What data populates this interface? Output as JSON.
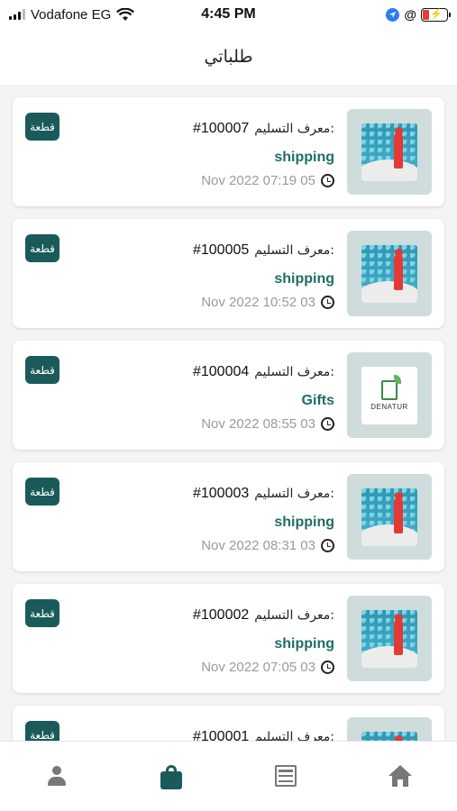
{
  "status_bar": {
    "carrier": "Vodafone EG",
    "time": "4:45 PM"
  },
  "header": {
    "title": "طلباتي"
  },
  "order_label": "معرف التسليم:",
  "badge_label": "قطعة",
  "orders": [
    {
      "id": "#100007",
      "category": "shipping",
      "date": "Nov 2022  07:19 05",
      "thumb": "red-figure-crowd"
    },
    {
      "id": "#100005",
      "category": "shipping",
      "date": "Nov 2022  10:52 03",
      "thumb": "red-figure-crowd"
    },
    {
      "id": "#100004",
      "category": "Gifts",
      "date": "Nov 2022  08:55 03",
      "thumb": "denatur-logo"
    },
    {
      "id": "#100003",
      "category": "shipping",
      "date": "Nov 2022  08:31 03",
      "thumb": "red-figure-crowd"
    },
    {
      "id": "#100002",
      "category": "shipping",
      "date": "Nov 2022  07:05 03",
      "thumb": "red-figure-crowd"
    },
    {
      "id": "#100001",
      "category": "",
      "date": "",
      "thumb": "red-figure-crowd"
    }
  ],
  "logo_text": "DENATUR",
  "tabbar": {
    "items": [
      "profile-icon",
      "orders-bag-icon",
      "list-icon",
      "home-icon"
    ],
    "active": "orders-bag-icon",
    "active_color": "#1a5a5a"
  },
  "colors": {
    "accent": "#1a5a5a",
    "category": "#1f6e64"
  }
}
